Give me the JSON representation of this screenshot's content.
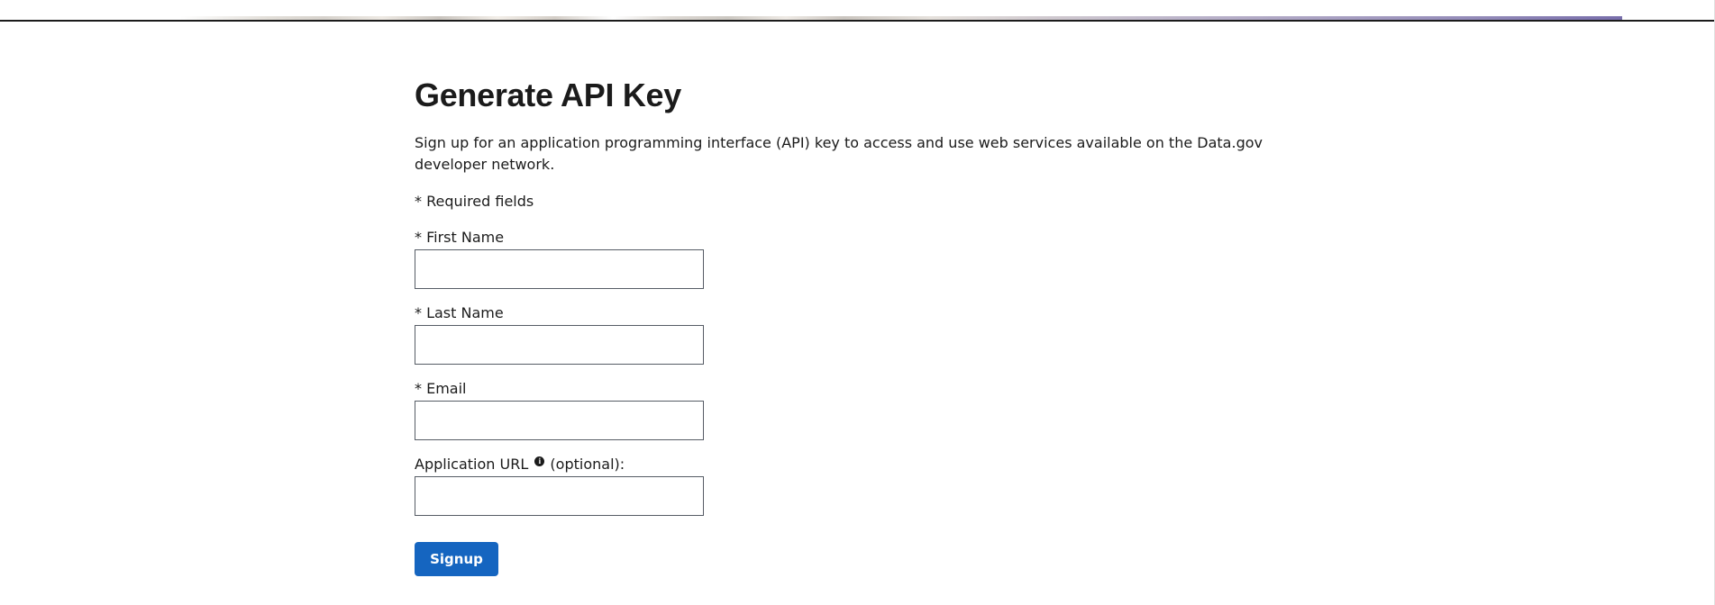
{
  "page": {
    "title": "Generate API Key",
    "intro": "Sign up for an application programming interface (API) key to access and use web services available on the Data.gov developer network.",
    "required_note": "* Required fields"
  },
  "form": {
    "first_name": {
      "label": "* First Name",
      "value": ""
    },
    "last_name": {
      "label": "* Last Name",
      "value": ""
    },
    "email": {
      "label": "* Email",
      "value": ""
    },
    "app_url": {
      "label_prefix": "Application URL",
      "label_suffix": "(optional):",
      "info_icon": "info-icon",
      "value": ""
    },
    "signup_label": "Signup"
  },
  "colors": {
    "button_bg": "#1565c0",
    "text": "#1b1b1b",
    "input_border": "#565c65"
  }
}
